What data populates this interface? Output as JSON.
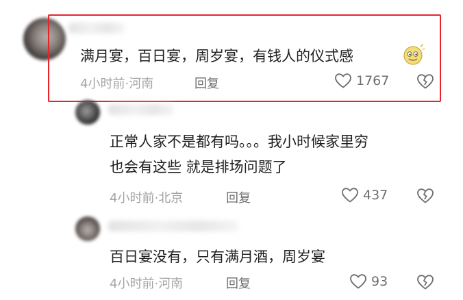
{
  "comments": [
    {
      "text": "满月宴，百日宴，周岁宴，有钱人的仪式感",
      "time": "4小时前",
      "location": "河南",
      "reply_label": "回复",
      "likes": "1767",
      "emoji": "smile-emoji"
    },
    {
      "text_line1": "正常人家不是都有吗。。。我小时候家里穷",
      "text_line2": "也会有这些 就是排场问题了",
      "time": "4小时前",
      "location": "北京",
      "reply_label": "回复",
      "likes": "437"
    },
    {
      "text": "百日宴没有，只有满月酒，周岁宴",
      "time": "4小时前",
      "location": "河南",
      "reply_label": "回复",
      "likes": "93"
    }
  ],
  "separator": "·",
  "colors": {
    "highlight_border": "#e8242a",
    "meta_text": "#a3a3a3",
    "icon": "#6e6e6e"
  },
  "icons": {
    "like": "heart-outline-icon",
    "dislike": "broken-heart-icon"
  }
}
